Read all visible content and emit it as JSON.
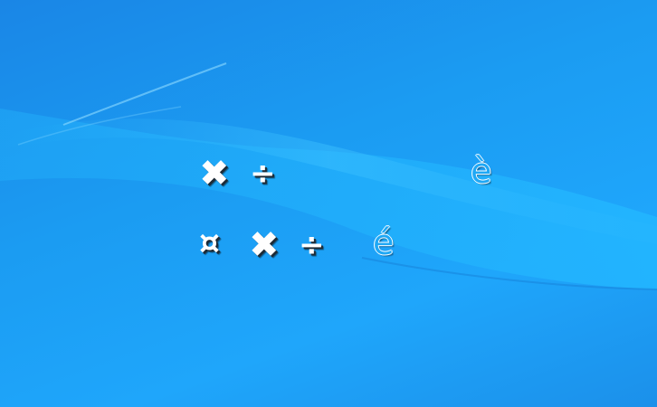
{
  "desktop": {
    "background_color": "#1b9cf2",
    "wave_color": "#22b3ff"
  },
  "icons": {
    "row1": [
      {
        "name": "multiply-icon",
        "glyph": "✖"
      },
      {
        "name": "divide-icon",
        "glyph": "÷"
      },
      {
        "name": "e-grave-icon",
        "glyph": "è"
      }
    ],
    "row2": [
      {
        "name": "currency-icon",
        "glyph": "¤"
      },
      {
        "name": "multiply-icon",
        "glyph": "✖"
      },
      {
        "name": "divide-icon",
        "glyph": "÷"
      },
      {
        "name": "e-acute-icon",
        "glyph": "é"
      }
    ]
  }
}
